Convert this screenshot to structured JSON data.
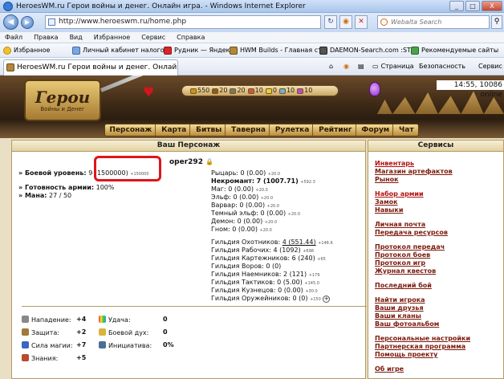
{
  "window": {
    "title": "HeroesWM.ru Герои войны и денег. Онлайн игра. - Windows Internet Explorer",
    "controls": [
      "_",
      "□",
      "X"
    ]
  },
  "address": {
    "url": "http://www.heroeswm.ru/home.php",
    "search_placeholder": "Webalta Search",
    "tool_icons": [
      "refresh-icon",
      "rss-icon",
      "stop-icon"
    ]
  },
  "menu": [
    "Файл",
    "Правка",
    "Вид",
    "Избранное",
    "Сервис",
    "Справка"
  ],
  "favorites": {
    "label": "Избранное",
    "links": [
      "Личный кабинет налого...",
      "Рудник — Яндекс",
      "HWM Builds - Главная ст...",
      "DAEMON-Search.com :ST...",
      "Рекомендуемые сайты"
    ]
  },
  "tab": {
    "title": "HeroesWM.ru Герои войны и денег. Онлайн иг..."
  },
  "commandbar": {
    "page": "Страница",
    "safety": "Безопасность",
    "tools": "Сервис"
  },
  "game": {
    "logo_title": "Герои",
    "logo_subtitle": "Войны и Денег",
    "server_time": "14:55, 10086 online",
    "resources": [
      "550",
      "20",
      "20",
      "10",
      "0",
      "10",
      "10"
    ],
    "nav": [
      "Персонаж",
      "Карта",
      "Битвы",
      "Таверна",
      "Рулетка",
      "Рейтинг",
      "Форум",
      "Чат"
    ],
    "colors": {
      "gold": "#c7951c",
      "link": "#7a1a0d",
      "highlight": "#e0141a"
    }
  },
  "character": {
    "panel_title": "Ваш Персонаж",
    "name_tail": "oper292",
    "combat_level_label": "» Боевой уровень:",
    "combat_level_value": "9",
    "combat_exp": "(1500000)",
    "combat_exp_delta": "+150000",
    "army_ready_label": "» Готовность армии:",
    "army_ready_value": "100%",
    "mana_label": "» Мана:",
    "mana_value": "27 / 50",
    "factions": [
      {
        "name": "Рыцарь:",
        "value": "0 (0.00)",
        "delta": "+20.0"
      },
      {
        "name": "Некромант:",
        "value": "7 (1007.71)",
        "delta": "+592.3"
      },
      {
        "name": "Маг:",
        "value": "0 (0.00)",
        "delta": "+20.0"
      },
      {
        "name": "Эльф:",
        "value": "0 (0.00)",
        "delta": "+20.0"
      },
      {
        "name": "Варвар:",
        "value": "0 (0.00)",
        "delta": "+20.0"
      },
      {
        "name": "Темный эльф:",
        "value": "0 (0.00)",
        "delta": "+20.0"
      },
      {
        "name": "Демон:",
        "value": "0 (0.00)",
        "delta": "+20.0"
      },
      {
        "name": "Гном:",
        "value": "0 (0.00)",
        "delta": "+20.0"
      }
    ],
    "guilds": [
      {
        "name": "Гильдия Охотников:",
        "value": "4 (551.44)",
        "delta": "+148.6"
      },
      {
        "name": "Гильдия Рабочих:",
        "value": "4 (1092)",
        "delta": "+698"
      },
      {
        "name": "Гильдия Картежников:",
        "value": "6 (240)",
        "delta": "+65"
      },
      {
        "name": "Гильдия Воров:",
        "value": "0 (0)",
        "delta": ""
      },
      {
        "name": "Гильдия Наемников:",
        "value": "2 (121)",
        "delta": "+179"
      },
      {
        "name": "Гильдия Тактиков:",
        "value": "0 (5.00)",
        "delta": "+145.0"
      },
      {
        "name": "Гильдия Кузнецов:",
        "value": "0 (0.00)",
        "delta": "+30.0"
      },
      {
        "name": "Гильдия Оружейников:",
        "value": "0 (0)",
        "delta": "+150"
      }
    ],
    "stats": [
      {
        "name": "Нападение:",
        "value": "+4"
      },
      {
        "name": "Защита:",
        "value": "+2"
      },
      {
        "name": "Сила магии:",
        "value": "+7"
      },
      {
        "name": "Знания:",
        "value": "+5"
      }
    ],
    "stats2": [
      {
        "name": "Удача:",
        "value": "0"
      },
      {
        "name": "Боевой дух:",
        "value": "0"
      },
      {
        "name": "Инициатива:",
        "value": "0%"
      }
    ]
  },
  "services": {
    "panel_title": "Сервисы",
    "links": [
      "Инвентарь",
      "Магазин артефактов",
      "Рынок",
      "Набор армии",
      "Замок",
      "Навыки",
      "Личная почта",
      "Передача ресурсов",
      "Протокол передач",
      "Протокол боев",
      "Протокол игр",
      "Журнал квестов",
      "Последний бой",
      "Найти игрока",
      "Ваши друзья",
      "Ваши кланы",
      "Ваш фотоальбом",
      "Персональные настройки",
      "Партнерская программа",
      "Помощь проекту",
      "Об игре"
    ]
  }
}
